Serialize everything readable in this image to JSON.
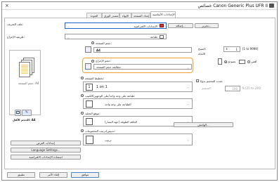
{
  "window": {
    "title": "خصائص Canon Generic Plus UFR II",
    "close_glyph": "×"
  },
  "tabs": [
    "الإعدادات الأساسية",
    "إعداد الصفحة",
    "الإنهاء",
    "مصدر الورق",
    "الجودة"
  ],
  "toolbar": {
    "profile_label": "ملف التعريف:",
    "profile_value": "الإعدادات الافتراضية",
    "add_button": "إضافة...",
    "edit_button": "تحرير...",
    "output_method_label": "طريقة الإخراج:",
    "output_method_value": "طباعة"
  },
  "page_size": {
    "label": "حجم الصفحة:",
    "value": "A4"
  },
  "output_size": {
    "label": "حجم الإخراج:",
    "value": "مطابقة حجم الصفحة"
  },
  "copies": {
    "label": "النسخ:",
    "value": "1",
    "range": "[1 to 9999]"
  },
  "orientation": {
    "label": "الاتجاه",
    "portrait": "عمودي",
    "landscape": "أفقي"
  },
  "page_layout": {
    "label": "تخطيط الصفحة:",
    "value": "1 on 1",
    "number": "1"
  },
  "manual_scaling": {
    "label": "تحديد التحجيم يدويًا",
    "scaling_label": "التحجيم:",
    "scaling_value": "100",
    "scaling_range": "% [25 to 200]"
  },
  "one_two_sided": {
    "label": "طباعة على وجه واحد/على الوجهين/الكتيب:",
    "value": "الطباعة على وجه واحد"
  },
  "binding_location": {
    "label": "موقع التجليد:",
    "value": "الحافة الطويلة (جهة اليسار)"
  },
  "staple": {
    "label": "تدبيس/ترتيب المجموعات:",
    "value": "ترتيب"
  },
  "gutter_button": "الهامش...",
  "preview": {
    "caption": "حجم الصفحة: A4",
    "footer": "الحجم الأقل: A4"
  },
  "left_buttons": [
    "إعدادات العرض",
    "Language Settings...",
    "استعادة الإعدادات الافتراضية"
  ],
  "bottom_buttons": [
    "موافق",
    "إلغاء الأمر",
    "تطبيق"
  ]
}
